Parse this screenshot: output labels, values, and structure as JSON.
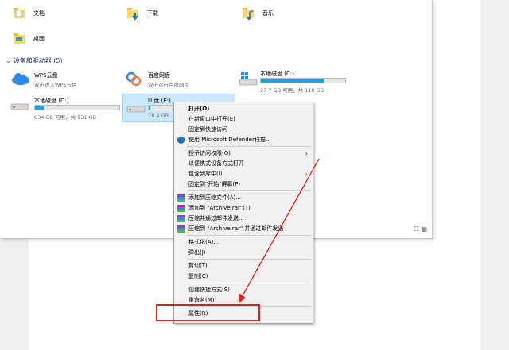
{
  "quick_access": [
    {
      "label": "文档",
      "icon": "documents-folder-icon"
    },
    {
      "label": "下载",
      "icon": "downloads-folder-icon"
    },
    {
      "label": "音乐",
      "icon": "music-folder-icon"
    },
    {
      "label": "桌面",
      "icon": "desktop-folder-icon"
    }
  ],
  "devices_section": {
    "title": "设备和驱动器 (5)"
  },
  "drives": [
    {
      "name": "WPS云盘",
      "desc": "双击进入WPS云盘",
      "icon": "wps-cloud-icon"
    },
    {
      "name": "百度网盘",
      "desc": "双击运行百度网盘",
      "icon": "baidu-netdisk-icon"
    },
    {
      "name": "本地磁盘 (C:)",
      "desc": "27.7 GB 可用，共 110 GB",
      "usage": 0.75,
      "icon": "windows-drive-icon"
    },
    {
      "name": "本地磁盘 (D:)",
      "desc": "834 GB 可用，共 931 GB",
      "usage": 0.1,
      "icon": "hard-drive-icon"
    },
    {
      "name": "U 盘 (E:)",
      "desc": "28.4 GB",
      "usage": 0.05,
      "icon": "usb-drive-icon"
    }
  ],
  "context_menu": {
    "open": "打开(O)",
    "open_new_window": "在新窗口中打开(E)",
    "pin_quick_access": "固定到快速访问",
    "defender_scan": "使用 Microsoft Defender扫描...",
    "grant_access": "授予访问权限(G)",
    "open_portable": "以便携式设备方式打开",
    "include_library": "包含到库中(I)",
    "pin_start": "固定到\"开始\"屏幕(P)",
    "add_archive": "添加到压缩文件(A)...",
    "add_archive_rar": "添加到 \"Archive.rar\"(T)",
    "compress_email": "压缩并通过邮件发送...",
    "compress_rar_email": "压缩到 \"Archive.rar\" 并通过邮件发送",
    "format": "格式化(A)...",
    "eject": "弹出(J)",
    "cut": "剪切(T)",
    "copy": "复制(C)",
    "create_shortcut": "创建快捷方式(S)",
    "rename": "重命名(M)",
    "properties": "属性(R)"
  },
  "colors": {
    "highlight": "#e0201b",
    "bar": "#26a0da",
    "selection": "#cce8ff"
  }
}
